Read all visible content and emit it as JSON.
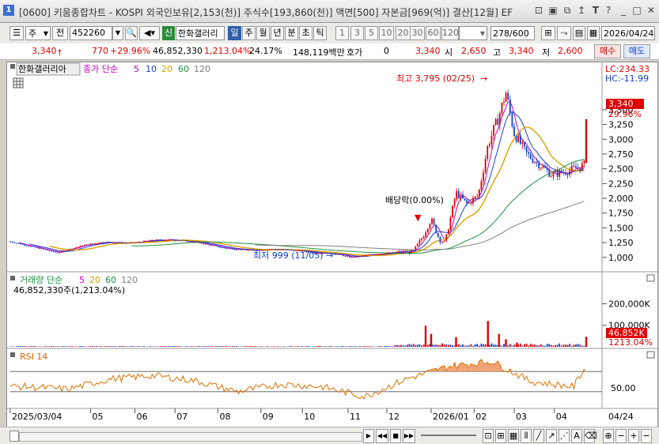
{
  "window": {
    "icon": "1",
    "title": "[0600] 키움종합차트 - KOSPI 외국인보유[2,153(천)] 주식수[193,860(천)] 액면[500] 자본금[969(억)] 결산[12월] EF"
  },
  "toolbar": {
    "market": "주",
    "prev": "전",
    "code": "452260",
    "sin": "신",
    "stock_name": "한화갤러리",
    "periods": [
      "일",
      "주",
      "월",
      "년",
      "분",
      "초",
      "틱"
    ],
    "selected_period": "일",
    "intervals": [
      "1",
      "3",
      "5",
      "10",
      "20",
      "30",
      "60",
      "120"
    ],
    "count": "278",
    "count_total": "/600",
    "date": "2026/04/24"
  },
  "pricebar": {
    "price": "3,340",
    "change": "770",
    "change_pct": "+29.96%",
    "volume": "46,852,330",
    "volume_pct": "1,213.04%",
    "turnover": "24.17%",
    "amount": "148,119백만",
    "hoga_label": "호가",
    "hoga_value": "0",
    "hoga_price": "3,340",
    "open_label": "시",
    "open": "2,650",
    "high_label": "고",
    "high": "3,340",
    "low_label": "저",
    "low": "2,600",
    "buy": "매수",
    "sell": "매도"
  },
  "price_panel": {
    "stock_tag": "한화갤러리아",
    "ma_label": "종가 단순",
    "ma_periods": [
      "5",
      "10",
      "20",
      "60",
      "120"
    ],
    "ma_colors": [
      "#c000c0",
      "#2040d0",
      "#e0a000",
      "#209040",
      "#808080"
    ],
    "lc": "LC:234.33",
    "hc": "HC:-11.99",
    "current_price_tag": "3,340",
    "current_pct_tag": "29.96%",
    "annotation_high": "최고 3,795 (02/25)",
    "annotation_low": "최저 999 (11/05)",
    "annotation_div": "배당락(0.00%)"
  },
  "volume_panel": {
    "label": "거래량 단순",
    "ma_periods": [
      "5",
      "20",
      "60",
      "120"
    ],
    "subtitle": "46,852,330주(1,213.04%)",
    "current_tag": "46,852K",
    "current_pct_tag": "1213.04%"
  },
  "rsi_panel": {
    "label": "RSI 14",
    "y_tick": "50.00"
  },
  "x_axis": {
    "ticks": [
      "2025/03/04",
      "05",
      "06",
      "07",
      "08",
      "09",
      "10",
      "11",
      "12",
      "2026/01",
      "02",
      "03",
      "04"
    ],
    "current_date": "04/24"
  },
  "chart_data": [
    {
      "type": "candlestick",
      "title": "한화갤러리아",
      "ylabel": "",
      "y_ticks": [
        1000,
        1250,
        1500,
        1750,
        2000,
        2250,
        2500,
        2750,
        3000,
        3250,
        3500
      ],
      "ylim": [
        850,
        3900
      ],
      "series_price_points": [
        [
          "2025-03-04",
          1270
        ],
        [
          "2025-03-20",
          1180
        ],
        [
          "2025-04-07",
          1080
        ],
        [
          "2025-04-25",
          1200
        ],
        [
          "2025-05-10",
          1260
        ],
        [
          "2025-05-30",
          1240
        ],
        [
          "2025-06-15",
          1290
        ],
        [
          "2025-07-01",
          1300
        ],
        [
          "2025-07-20",
          1240
        ],
        [
          "2025-08-05",
          1160
        ],
        [
          "2025-08-25",
          1120
        ],
        [
          "2025-09-10",
          1140
        ],
        [
          "2025-09-25",
          1120
        ],
        [
          "2025-10-10",
          1080
        ],
        [
          "2025-10-25",
          1060
        ],
        [
          "2025-11-05",
          999
        ],
        [
          "2025-11-20",
          1050
        ],
        [
          "2025-12-05",
          1080
        ],
        [
          "2025-12-20",
          1100
        ],
        [
          "2025-12-27",
          1350
        ],
        [
          "2026-01-02",
          1650
        ],
        [
          "2026-01-08",
          1300
        ],
        [
          "2026-01-12",
          1250
        ],
        [
          "2026-01-20",
          2100
        ],
        [
          "2026-01-28",
          1900
        ],
        [
          "2026-02-05",
          2050
        ],
        [
          "2026-02-12",
          2900
        ],
        [
          "2026-02-20",
          3400
        ],
        [
          "2026-02-25",
          3795
        ],
        [
          "2026-03-03",
          3100
        ],
        [
          "2026-03-12",
          2750
        ],
        [
          "2026-03-20",
          2600
        ],
        [
          "2026-03-30",
          2400
        ],
        [
          "2026-04-08",
          2450
        ],
        [
          "2026-04-16",
          2500
        ],
        [
          "2026-04-23",
          2570
        ],
        [
          "2026-04-24",
          3340
        ]
      ],
      "high": {
        "value": 3795,
        "date": "02/25"
      },
      "low": {
        "value": 999,
        "date": "11/05"
      }
    },
    {
      "type": "bar",
      "title": "거래량",
      "y_ticks_labels": [
        "200,000K",
        "100,000K"
      ],
      "y_ticks": [
        200000,
        100000
      ],
      "ylim": [
        0,
        220000
      ],
      "unit": "K",
      "spikes": [
        [
          "2025-12-29",
          98000
        ],
        [
          "2026-01-02",
          60000
        ],
        [
          "2026-01-20",
          45000
        ],
        [
          "2026-02-12",
          120000
        ],
        [
          "2026-02-20",
          60000
        ],
        [
          "2026-02-25",
          35000
        ],
        [
          "2026-03-05",
          20000
        ],
        [
          "2026-04-24",
          46852
        ]
      ]
    },
    {
      "type": "line",
      "title": "RSI 14",
      "y_ticks": [
        50
      ],
      "ylim": [
        0,
        100
      ],
      "points": [
        [
          "2025-03",
          40
        ],
        [
          "2025-04",
          35
        ],
        [
          "2025-05",
          55
        ],
        [
          "2025-06",
          62
        ],
        [
          "2025-07",
          52
        ],
        [
          "2025-08",
          30
        ],
        [
          "2025-09",
          45
        ],
        [
          "2025-10",
          40
        ],
        [
          "2025-11",
          20
        ],
        [
          "2025-12",
          55
        ],
        [
          "2026-01",
          80
        ],
        [
          "2026-02",
          90
        ],
        [
          "2026-03",
          50
        ],
        [
          "2026-04",
          40
        ],
        [
          "2026-04-24",
          83
        ]
      ]
    }
  ]
}
